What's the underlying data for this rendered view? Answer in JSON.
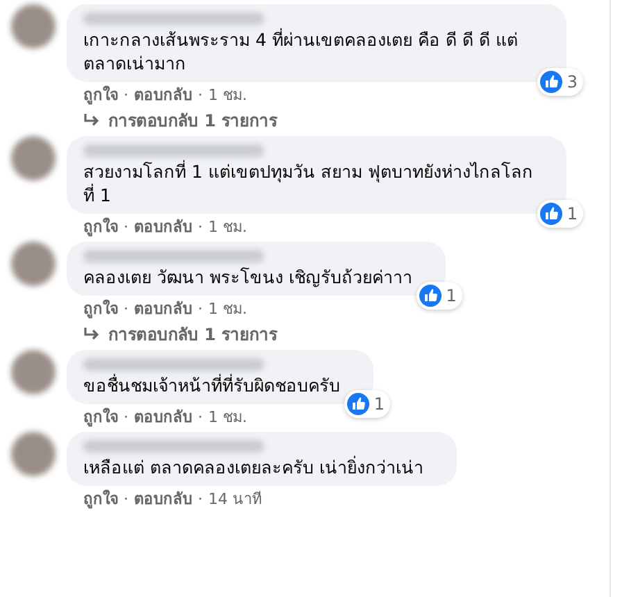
{
  "comments": [
    {
      "text": "เกาะกลางเส้นพระราม 4 ที่ผ่านเขตคลองเตย คือ ดี ดี ดี แต่ตลาดเน่ามาก",
      "likes": "3",
      "like_label": "ถูกใจ",
      "separator_1": "·",
      "reply_label": "ตอบกลับ",
      "separator_2": "·",
      "time": "1 ชม.",
      "replies": "การตอบกลับ 1 รายการ"
    },
    {
      "text": "สวยงามโลกที่ 1 แต่เขตปทุมวัน สยาม ฟุตบาทยังห่างไกลโลกที่ 1",
      "likes": "1",
      "like_label": "ถูกใจ",
      "separator_1": "·",
      "reply_label": "ตอบกลับ",
      "separator_2": "·",
      "time": "1 ชม."
    },
    {
      "text": "คลองเตย วัฒนา พระโขนง เชิญรับถ้วยค่าาา",
      "likes": "1",
      "like_label": "ถูกใจ",
      "separator_1": "·",
      "reply_label": "ตอบกลับ",
      "separator_2": "·",
      "time": "1 ชม.",
      "replies": "การตอบกลับ 1 รายการ"
    },
    {
      "text": "ขอชื่นชมเจ้าหน้าที่ที่รับผิดชอบครับ",
      "likes": "1",
      "like_label": "ถูกใจ",
      "separator_1": "·",
      "reply_label": "ตอบกลับ",
      "separator_2": "·",
      "time": "1 ชม."
    },
    {
      "text": "เหลือแต่ ตลาดคลองเตยละครับ เน่ายิ่งกว่าเน่า",
      "like_label": "ถูกใจ",
      "separator_1": "·",
      "reply_label": "ตอบกลับ",
      "separator_2": "·",
      "time": "14 นาที"
    }
  ]
}
